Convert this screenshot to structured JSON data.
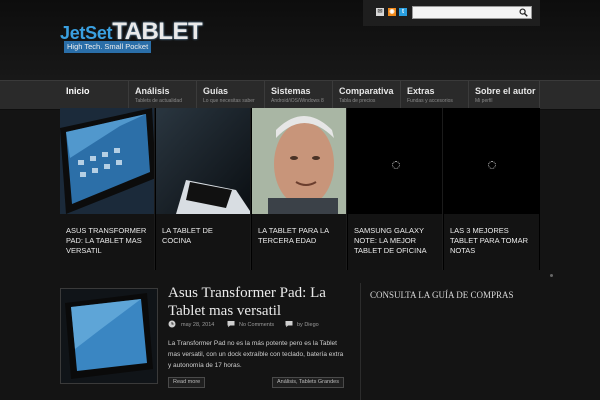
{
  "header": {
    "logo_part1": "JetSet",
    "logo_part2": "TABLET",
    "tagline": "High Tech. Small Pocket",
    "search_placeholder": ""
  },
  "social": [
    {
      "name": "email-icon"
    },
    {
      "name": "rss-icon"
    },
    {
      "name": "twitter-icon"
    }
  ],
  "nav": [
    {
      "label": "Inicio",
      "sub": ""
    },
    {
      "label": "Análisis",
      "sub": "Tablets de actualidad"
    },
    {
      "label": "Guías",
      "sub": "Lo que necesitas saber"
    },
    {
      "label": "Sistemas",
      "sub": "Android/iOS/Windows 8"
    },
    {
      "label": "Comparativa",
      "sub": "Tabla de precios"
    },
    {
      "label": "Extras",
      "sub": "Fundas y accesorios"
    },
    {
      "label": "Sobre el autor",
      "sub": "Mi perfil"
    }
  ],
  "slides": [
    {
      "caption": "Asus Transformer Pad: la tablet mas versatil"
    },
    {
      "caption": "La tablet de cocina"
    },
    {
      "caption": "La tablet para la tercera edad"
    },
    {
      "caption": "Samsung Galaxy Note: la mejor tablet de oficina"
    },
    {
      "caption": "Las 3 mejores tablet para tomar notas"
    }
  ],
  "post": {
    "title": "Asus Transformer Pad: La Tablet mas versatil",
    "date": "may 28, 2014",
    "comments": "No Comments",
    "author": "by Diego",
    "excerpt": "La Transformer Pad no es la más potente pero es la Tablet mas versatil, con un dock extraíble con teclado, batería extra y autonomía de 17 horas.",
    "read_more": "Read more",
    "categories": "Análisis, Tablets Grandes"
  },
  "sidebar": {
    "title": "CONSULTA LA GUÍA DE COMPRAS"
  },
  "colors": {
    "background": "#141414",
    "nav": "#2a2a2a",
    "logo_blue": "#3aa0e0"
  }
}
